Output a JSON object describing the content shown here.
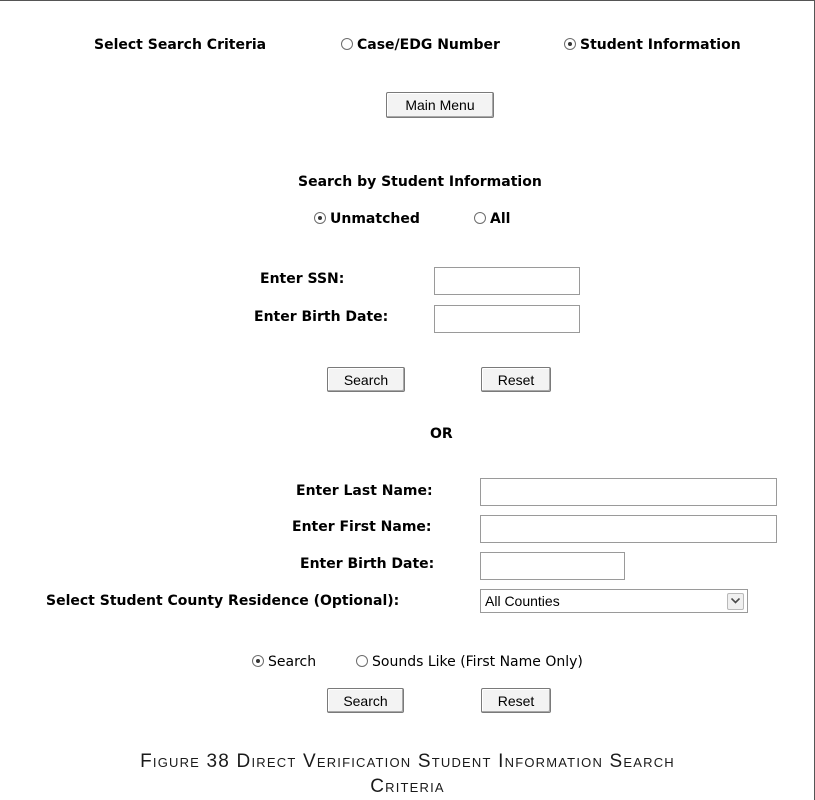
{
  "criteria": {
    "label": "Select Search Criteria",
    "options": [
      {
        "label": "Case/EDG Number",
        "checked": false
      },
      {
        "label": "Student Information",
        "checked": true
      }
    ]
  },
  "main_menu_label": "Main Menu",
  "student_section": {
    "heading": "Search by Student Information",
    "match_options": [
      {
        "label": "Unmatched",
        "checked": true
      },
      {
        "label": "All",
        "checked": false
      }
    ],
    "ssn_label": "Enter SSN:",
    "ssn_value": "",
    "birth_date_label": "Enter Birth Date:",
    "birth_date_value": "",
    "search_label": "Search",
    "reset_label": "Reset"
  },
  "or_label": "OR",
  "name_section": {
    "last_name_label": "Enter Last Name:",
    "last_name_value": "",
    "first_name_label": "Enter First Name:",
    "first_name_value": "",
    "birth_date_label": "Enter Birth Date:",
    "birth_date_value": "",
    "county_label": "Select Student County Residence (Optional):",
    "county_selected": "All Counties",
    "search_mode_options": [
      {
        "label": "Search",
        "checked": true
      },
      {
        "label": "Sounds Like (First Name Only)",
        "checked": false
      }
    ],
    "search_label": "Search",
    "reset_label": "Reset"
  },
  "caption": {
    "line1": "Figure 38 Direct Verification Student Information Search",
    "line2": "Criteria"
  }
}
